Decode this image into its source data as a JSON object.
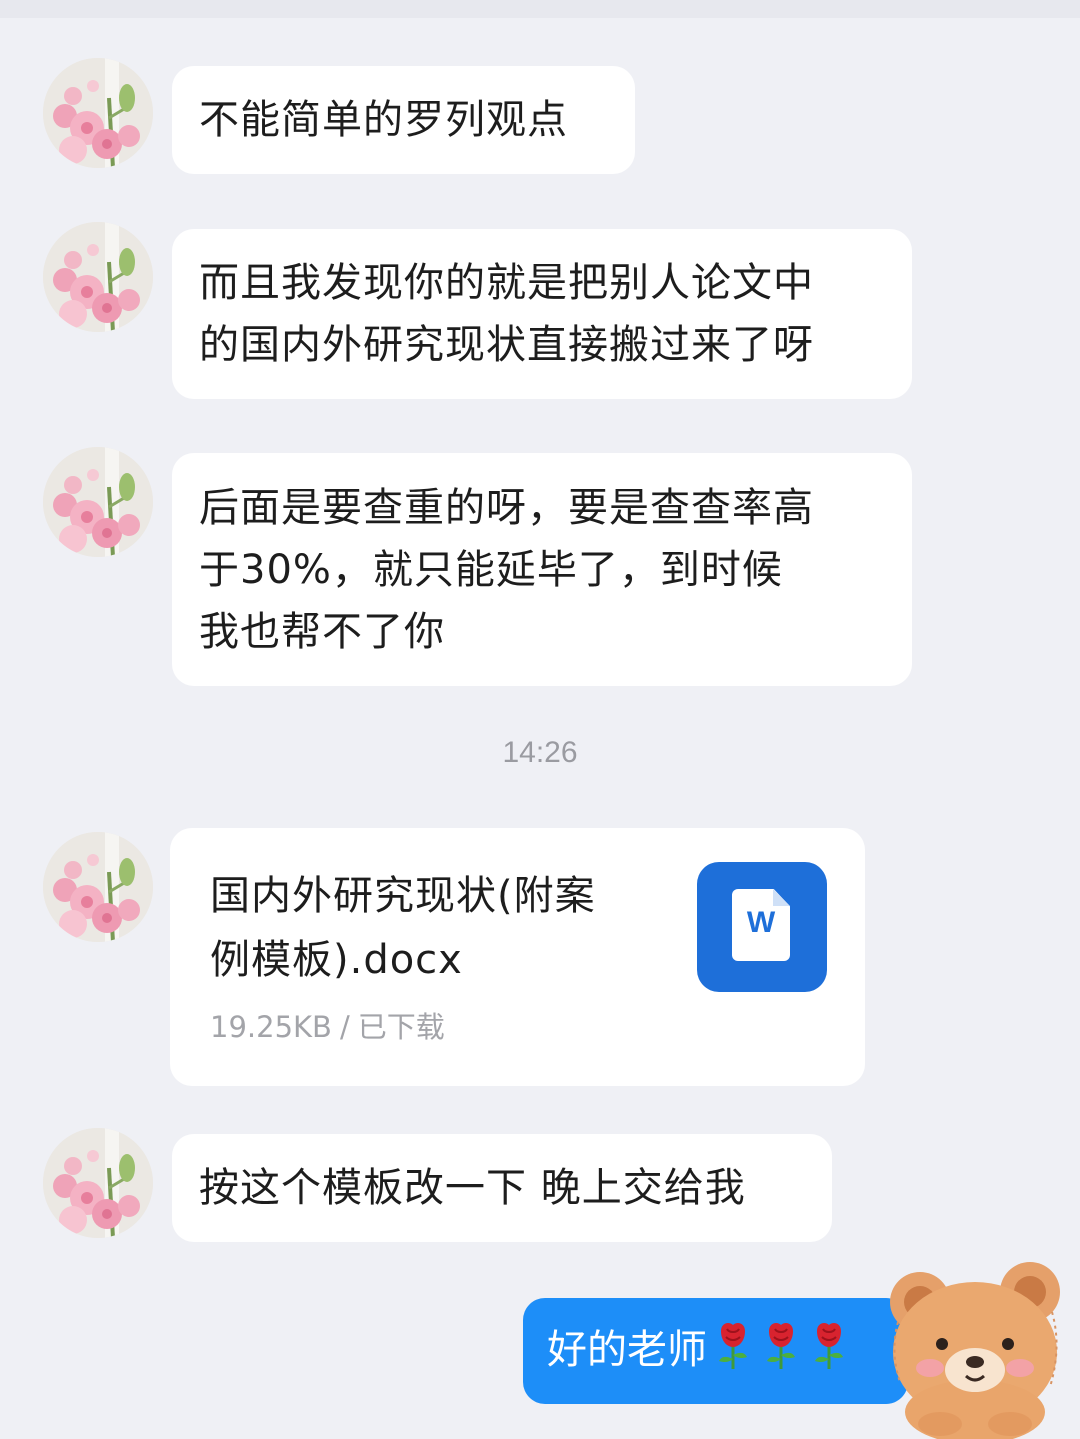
{
  "messages": [
    {
      "text": "不能简单的罗列观点"
    },
    {
      "text": "而且我发现你的就是把别人论文中\n的国内外研究现状直接搬过来了呀"
    },
    {
      "text": "后面是要查重的呀，要是查查率高\n于30%，就只能延毕了，到时候\n我也帮不了你"
    }
  ],
  "timestamp": "14:26",
  "file": {
    "name": "国内外研究现状(附案\n例模板).docx",
    "size": "19.25KB",
    "separator": "/",
    "status": "已下载",
    "icon_letter": "W",
    "icon_name": "word-file-icon",
    "icon_color": "#1e6fd9"
  },
  "message_after_file": {
    "text": "按这个模板改一下 晚上交给我"
  },
  "reply": {
    "text": "好的老师",
    "emoji": [
      "rose-icon",
      "rose-icon",
      "rose-icon"
    ],
    "bubble_color": "#1d8ef8"
  },
  "colors": {
    "background": "#eff0f5",
    "bubble": "#ffffff",
    "meta_text": "#a3a4a9"
  }
}
